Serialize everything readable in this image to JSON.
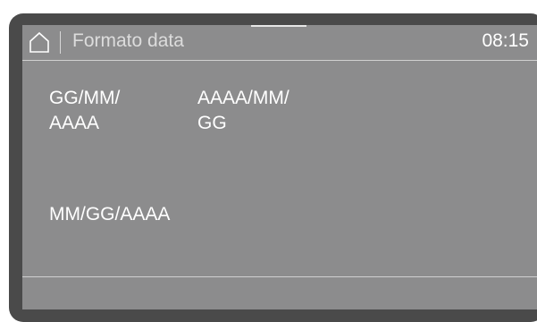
{
  "header": {
    "title": "Formato data",
    "clock": "08:15",
    "home_icon": "home-icon"
  },
  "options": [
    {
      "label_line1": "GG/MM/",
      "label_line2": "AAAA"
    },
    {
      "label_line1": "AAAA/MM/",
      "label_line2": "GG"
    },
    {
      "label_line1": "MM/GG/AAAA",
      "label_line2": ""
    }
  ],
  "colors": {
    "screen_bg": "#8c8c8d",
    "bezel": "#4a4a4a",
    "text": "#ffffff",
    "title_text": "#dcdcdc"
  }
}
